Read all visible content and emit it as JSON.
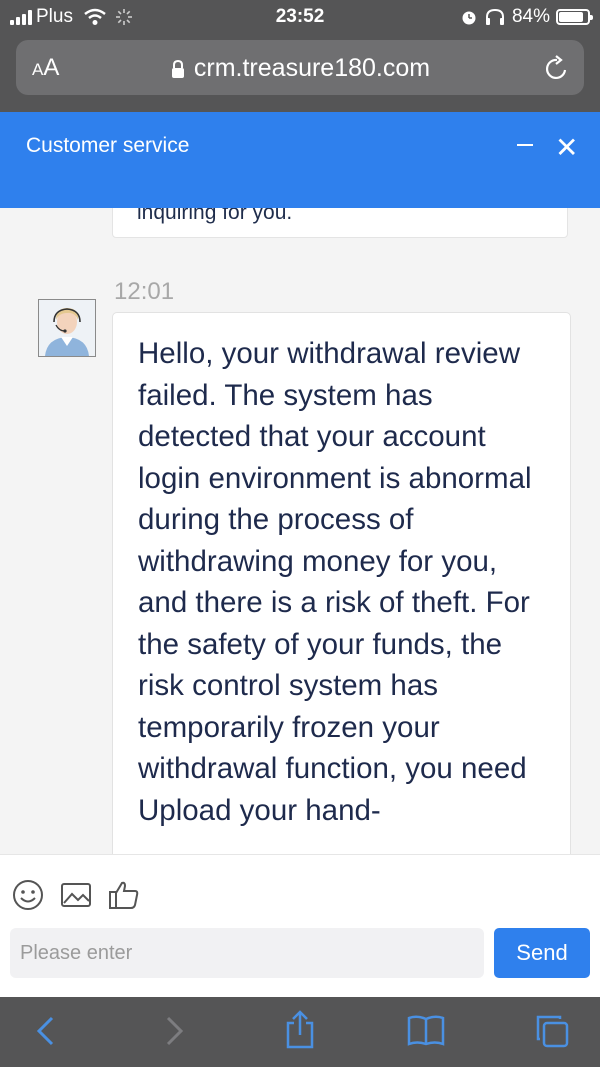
{
  "status_bar": {
    "carrier": "Plus",
    "time": "23:52",
    "battery": "84%",
    "battery_level": 0.84
  },
  "browser": {
    "aa_label_small": "A",
    "aa_label_large": "A",
    "url": "crm.treasure180.com",
    "icons": [
      "lock-icon",
      "reload-icon",
      "back-icon",
      "forward-icon",
      "share-icon",
      "bookmarks-icon",
      "tabs-icon"
    ]
  },
  "header": {
    "title": "Customer service"
  },
  "chat": {
    "previous_message_fragment": "inquiring for you.",
    "message_time": "12:01",
    "message_text": "Hello, your withdrawal review failed. The system has detected that your account login environment is abnormal during the process of withdrawing money for you, and there is a risk of theft. For the safety of your funds, the risk control system has temporarily frozen your withdrawal function, you need Upload your hand-"
  },
  "input": {
    "placeholder": "Please enter",
    "value": "",
    "send_label": "Send",
    "tool_icons": [
      "emoji-icon",
      "image-icon",
      "thumbs-up-icon"
    ]
  },
  "colors": {
    "accent": "#2f80ed",
    "chrome": "#555556",
    "text": "#1e2a4c"
  }
}
